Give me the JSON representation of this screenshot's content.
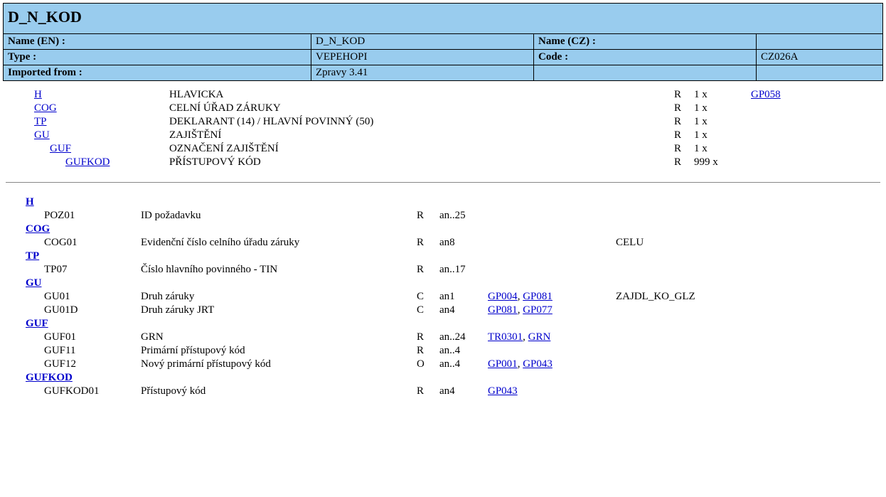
{
  "header": {
    "title": "D_N_KOD",
    "name_en_label": "Name (EN) :",
    "name_en_value": "D_N_KOD",
    "name_cz_label": "Name (CZ) :",
    "name_cz_value": "",
    "type_label": "Type :",
    "type_value": "VEPEHOPI",
    "code_label": "Code :",
    "code_value": "CZ026A",
    "imported_label": "Imported from :",
    "imported_value": "Zpravy 3.41"
  },
  "structure": [
    {
      "indent": 0,
      "code": "H",
      "desc": "HLAVICKA",
      "req": "R",
      "mult": "1 x",
      "links": [
        "GP058"
      ]
    },
    {
      "indent": 0,
      "code": "COG",
      "desc": "CELNÍ ÚŘAD ZÁRUKY",
      "req": "R",
      "mult": "1 x",
      "links": []
    },
    {
      "indent": 0,
      "code": "TP",
      "desc": "DEKLARANT (14) / HLAVNÍ POVINNÝ (50)",
      "req": "R",
      "mult": "1 x",
      "links": []
    },
    {
      "indent": 0,
      "code": "GU",
      "desc": "ZAJIŠTĚNÍ",
      "req": "R",
      "mult": "1 x",
      "links": []
    },
    {
      "indent": 1,
      "code": "GUF",
      "desc": "OZNAČENÍ ZAJIŠTĚNÍ",
      "req": "R",
      "mult": "1 x",
      "links": []
    },
    {
      "indent": 2,
      "code": "GUFKOD",
      "desc": "PŘÍSTUPOVÝ KÓD",
      "req": "R",
      "mult": "999 x",
      "links": []
    }
  ],
  "details": [
    {
      "type": "section",
      "code": "H"
    },
    {
      "type": "field",
      "code": "POZ01",
      "desc": "ID požadavku",
      "req": "R",
      "fmt": "an..25",
      "refs": [],
      "extra": ""
    },
    {
      "type": "section",
      "code": "COG"
    },
    {
      "type": "field",
      "code": "COG01",
      "desc": "Evidenční číslo celního úřadu záruky",
      "req": "R",
      "fmt": "an8",
      "refs": [],
      "extra": "CELU"
    },
    {
      "type": "section",
      "code": "TP"
    },
    {
      "type": "field",
      "code": "TP07",
      "desc": "Číslo hlavního povinného - TIN",
      "req": "R",
      "fmt": "an..17",
      "refs": [],
      "extra": ""
    },
    {
      "type": "section",
      "code": "GU"
    },
    {
      "type": "field",
      "code": "GU01",
      "desc": "Druh záruky",
      "req": "C",
      "fmt": "an1",
      "refs": [
        "GP004",
        "GP081"
      ],
      "extra": "ZAJDL_KO_GLZ"
    },
    {
      "type": "field",
      "code": "GU01D",
      "desc": "Druh záruky JRT",
      "req": "C",
      "fmt": "an4",
      "refs": [
        "GP081",
        "GP077"
      ],
      "extra": ""
    },
    {
      "type": "section",
      "code": "GUF"
    },
    {
      "type": "field",
      "code": "GUF01",
      "desc": "GRN",
      "req": "R",
      "fmt": "an..24",
      "refs": [
        "TR0301",
        "GRN"
      ],
      "extra": ""
    },
    {
      "type": "field",
      "code": "GUF11",
      "desc": "Primární přístupový kód",
      "req": "R",
      "fmt": "an..4",
      "refs": [],
      "extra": ""
    },
    {
      "type": "field",
      "code": "GUF12",
      "desc": "Nový primární přístupový kód",
      "req": "O",
      "fmt": "an..4",
      "refs": [
        "GP001",
        "GP043"
      ],
      "extra": ""
    },
    {
      "type": "section",
      "code": "GUFKOD"
    },
    {
      "type": "field",
      "code": "GUFKOD01",
      "desc": "Přístupový kód",
      "req": "R",
      "fmt": "an4",
      "refs": [
        "GP043"
      ],
      "extra": ""
    }
  ]
}
